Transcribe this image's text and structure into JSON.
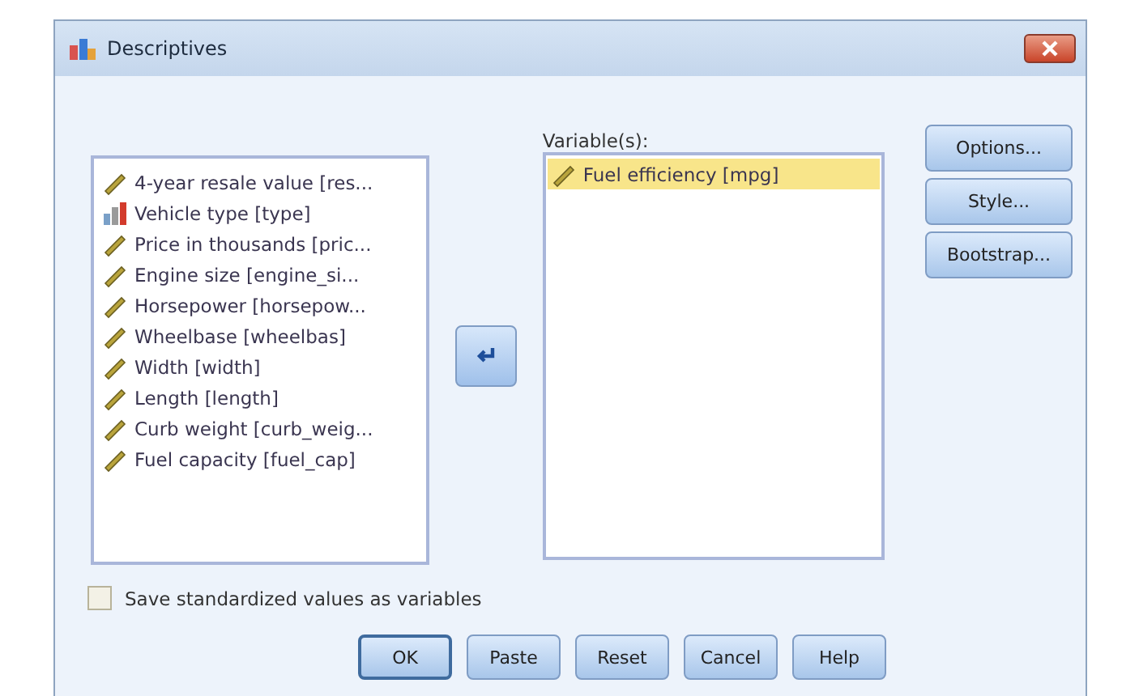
{
  "window": {
    "title": "Descriptives"
  },
  "source_list": [
    {
      "label": "4-year resale value [res...",
      "kind": "scale",
      "selected": false
    },
    {
      "label": "Vehicle type [type]",
      "kind": "nominal",
      "selected": false
    },
    {
      "label": "Price in thousands [pric...",
      "kind": "scale",
      "selected": false
    },
    {
      "label": "Engine size [engine_si...",
      "kind": "scale",
      "selected": false
    },
    {
      "label": "Horsepower [horsepow...",
      "kind": "scale",
      "selected": false
    },
    {
      "label": "Wheelbase [wheelbas]",
      "kind": "scale",
      "selected": false
    },
    {
      "label": "Width [width]",
      "kind": "scale",
      "selected": false
    },
    {
      "label": "Length [length]",
      "kind": "scale",
      "selected": false
    },
    {
      "label": "Curb weight [curb_weig...",
      "kind": "scale",
      "selected": false
    },
    {
      "label": "Fuel capacity [fuel_cap]",
      "kind": "scale",
      "selected": false
    }
  ],
  "variables": {
    "label": "Variable(s):",
    "items": [
      {
        "label": "Fuel efficiency [mpg]",
        "kind": "scale",
        "selected": true
      }
    ]
  },
  "side_buttons": [
    "Options...",
    "Style...",
    "Bootstrap..."
  ],
  "save_checkbox": {
    "label": "Save standardized values as variables",
    "checked": false
  },
  "buttons": [
    {
      "label": "OK",
      "default": true
    },
    {
      "label": "Paste",
      "default": false
    },
    {
      "label": "Reset",
      "default": false
    },
    {
      "label": "Cancel",
      "default": false
    },
    {
      "label": "Help",
      "default": false
    }
  ]
}
